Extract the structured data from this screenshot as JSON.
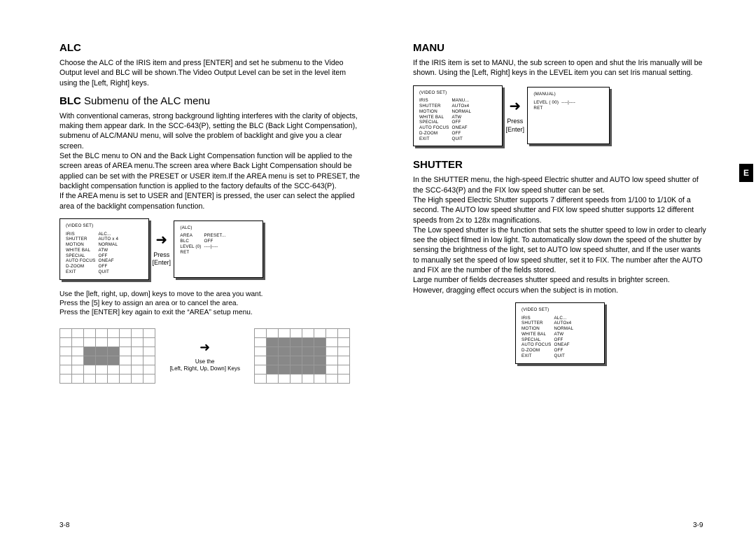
{
  "left": {
    "alc": {
      "title": "ALC",
      "para": "Choose the ALC of the IRIS item and press [ENTER] and set he submenu to the Video Output level and BLC will be shown.The Video Output Level can be set in the level item using the [Left, Right] keys."
    },
    "blc": {
      "title": "BLC",
      "subtitle": " Submenu of the ALC menu",
      "para": "With conventional cameras, strong background lighting interferes with the clarity of objects, making them appear dark.  In the SCC-643(P), setting the BLC (Back Light Compensation), submenu of ALC/MANU menu, will solve the problem of backlight and give you a clear screen.\nSet the BLC menu to ON and the Back Light Compensation function will be applied to the screen areas of AREA menu.The screen area where Back Light Compensation should be applied can be set with the PRESET or USER item.If the AREA menu is set to PRESET, the backlight compensation function is applied to the factory defaults of the SCC-643(P).\nIf the AREA menu is set to USER and [ENTER] is pressed, the user can select the applied area of the backlight compensation function.",
      "instructions": "Use the [left, right, up, down] keys to move to the area you want.\nPress the [5] key to assign an area or to cancel the area.\nPress the [ENTER] key again to exit the “AREA” setup menu."
    },
    "menu1": {
      "title": "(VIDEO SET)",
      "rows": [
        [
          "IRIS",
          "ALC..."
        ],
        [
          "SHUTTER",
          "AUTO x 4"
        ],
        [
          "MOTION",
          "NORMAL"
        ],
        [
          "WHITE BAL",
          "ATW"
        ],
        [
          "SPECIAL",
          "OFF"
        ],
        [
          "AUTO FOCUS",
          "ONEAF"
        ],
        [
          "D-ZOOM",
          "OFF"
        ],
        [
          "EXIT",
          "QUIT"
        ]
      ]
    },
    "arrow1": {
      "label1": "Press",
      "label2": "[Enter]"
    },
    "menu2": {
      "title": "(ALC)",
      "rows": [
        [
          "AREA",
          "PRESET..."
        ],
        [
          "BLC",
          "OFF"
        ],
        [
          "LEVEL (0)",
          "----|----"
        ],
        [
          "RET",
          ""
        ]
      ]
    },
    "gridarrow": {
      "a": "Use the",
      "b": "[Left, Right, Up, Down] Keys"
    },
    "pageno": "3-8"
  },
  "right": {
    "manu": {
      "title": "MANU",
      "para": "If the IRIS item is set to MANU, the sub screen to open and shut the Iris manually will be shown. Using the [Left, Right] keys in the LEVEL item you can set Iris manual setting."
    },
    "menu3": {
      "title": "(VIDEO SET)",
      "rows": [
        [
          "IRIS",
          "MANU..."
        ],
        [
          "SHUTTER",
          "AUTOx4"
        ],
        [
          "MOTION",
          "NORMAL"
        ],
        [
          "WHITE BAL",
          "ATW"
        ],
        [
          "SPECIAL",
          "OFF"
        ],
        [
          "AUTO FOCUS",
          "ONEAF"
        ],
        [
          "D-ZOOM",
          "OFF"
        ],
        [
          "EXIT",
          "QUIT"
        ]
      ]
    },
    "arrow2": {
      "label1": "Press",
      "label2": "[Enter]"
    },
    "menu4": {
      "title": "(MANUAL)",
      "rows": [
        [
          "LEVEL (  00)",
          "----|----"
        ],
        [
          "RET",
          ""
        ]
      ]
    },
    "shutter": {
      "title": "SHUTTER",
      "para": "In the SHUTTER menu, the high-speed Electric shutter and AUTO low speed shutter of the SCC-643(P) and the FIX low speed shutter can be set.\nThe High speed Electric Shutter supports 7 different speeds from 1/100 to 1/10K of a second. The AUTO low speed shutter and FIX low speed shutter supports 12 different speeds from 2x to 128x magnifications.\nThe Low speed shutter is the function that sets the shutter speed to low in order to clearly see the object filmed in low light.  To automatically slow down the speed of the shutter by sensing the brightness of the light, set to AUTO low speed shutter, and If the user wants to manually set the speed of low speed shutter, set it to FIX. The number after the AUTO and FIX are the number of the fields stored.\nLarge number of fields decreases shutter speed and results in brighter screen.\nHowever, dragging effect occurs when the subject is in motion."
    },
    "menu5": {
      "title": "(VIDEO SET)",
      "rows": [
        [
          "IRIS",
          "ALC..."
        ],
        [
          "SHUTTER",
          "AUTOx4"
        ],
        [
          "MOTION",
          "NORMAL"
        ],
        [
          "WHITE BAL",
          "ATW"
        ],
        [
          "SPECIAL",
          "OFF"
        ],
        [
          "AUTO FOCUS",
          "ONEAF"
        ],
        [
          "D-ZOOM",
          "OFF"
        ],
        [
          "EXIT",
          "QUIT"
        ]
      ]
    },
    "pageno": "3-9",
    "tab": "E"
  }
}
